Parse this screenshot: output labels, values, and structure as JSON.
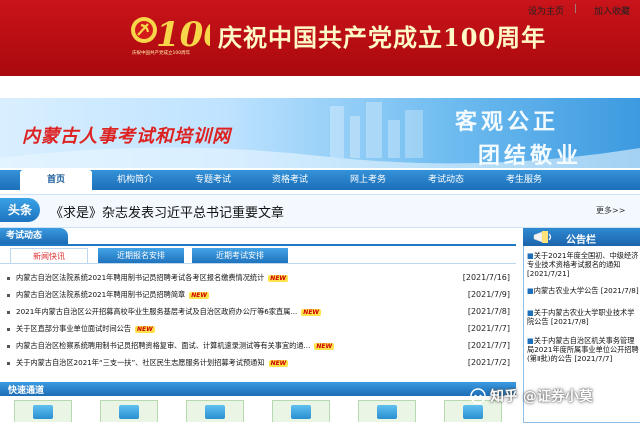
{
  "banner": {
    "title": "庆祝中国共产党成立100周年",
    "emblem_number": "100",
    "emblem_caption": "庆祝中国共产党成立100周年"
  },
  "toplinks": {
    "homepage": "设为主页",
    "favorite": "加入收藏",
    "sep": "|"
  },
  "header": {
    "site_title": "内蒙古人事考试和培训网",
    "slogan_line1": "客观公正",
    "slogan_line2": "团结敬业"
  },
  "nav": {
    "items": [
      "首页",
      "机构简介",
      "专题考试",
      "资格考试",
      "网上考务",
      "考试动态",
      "考生服务"
    ]
  },
  "headline": {
    "badge": "头条",
    "text": "《求是》杂志发表习近平总书记重要文章",
    "more": "更多>>"
  },
  "exam_news": {
    "title": "考试动态",
    "tabs": [
      "新闻快讯",
      "近期报名安排",
      "近期考试安排"
    ],
    "new_badge": "NEW",
    "items": [
      {
        "title": "内蒙古自治区法院系统2021年聘用制书记员招聘考试各考区报名缴费情况统计",
        "date": "[2021/7/16]"
      },
      {
        "title": "内蒙古自治区法院系统2021年聘用制书记员招聘简章",
        "date": "[2021/7/9]"
      },
      {
        "title": "2021年内蒙古自治区公开招募高校毕业生服务基层考试及自治区政府办公厅等6家直属...",
        "date": "[2021/7/8]"
      },
      {
        "title": "关于区直部分事业单位面试时间公告",
        "date": "[2021/7/7]"
      },
      {
        "title": "内蒙古自治区检察系统聘用制书记员招聘资格复审、面试、计算机速录测试等有关事宜的通...",
        "date": "[2021/7/7]"
      },
      {
        "title": "关于内蒙古自治区2021年“三支一扶”、社区民生志愿服务计划招募考试预通知",
        "date": "[2021/7/2]"
      }
    ]
  },
  "quick_channel": {
    "title": "快速通道"
  },
  "bulletin": {
    "title": "公告栏",
    "items": [
      "关于2021年度全国初、中级经济专业技术资格考试报名的通知 [2021/7/21]",
      "内蒙古农业大学公告 [2021/7/8]",
      "关于内蒙古农业大学职业技术学院公告 [2021/7/8]",
      "关于内蒙古自治区机关事务管理局2021年度所属事业单位公开招聘(第Ⅱ批)的公告 [2021/7/7]"
    ]
  },
  "watermark": {
    "text": "知乎 @证券小莫"
  }
}
